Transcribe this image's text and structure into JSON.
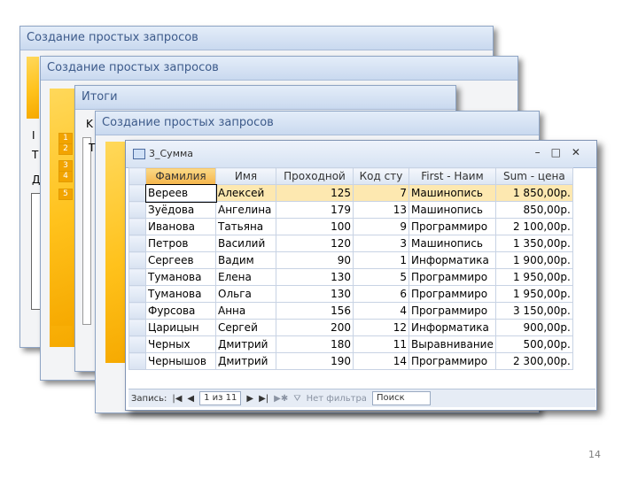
{
  "windows": {
    "w1_title": "Создание простых запросов",
    "w2_title": "Создание простых запросов",
    "w3_title": "Итоги",
    "w4_title": "Создание простых запросов",
    "w1_left_chars": [
      "I",
      "T",
      "Д"
    ],
    "w3_numbers": [
      "1",
      "2",
      "3",
      "4",
      "5"
    ],
    "w3_left_chars": [
      "K"
    ],
    "w4_left_chars": [
      "T"
    ]
  },
  "datasheet": {
    "title": "3_Сумма",
    "columns": [
      "Фамилия",
      "Имя",
      "Проходной",
      "Код сту",
      "First - Наим",
      "Sum - цена"
    ],
    "rows": [
      [
        "Вереев",
        "Алексей",
        "125",
        "7",
        "Машинопись",
        "1 850,00р."
      ],
      [
        "Зуёдова",
        "Ангелина",
        "179",
        "13",
        "Машинопись",
        "850,00р."
      ],
      [
        "Иванова",
        "Татьяна",
        "100",
        "9",
        "Программиро",
        "2 100,00р."
      ],
      [
        "Петров",
        "Василий",
        "120",
        "3",
        "Машинопись",
        "1 350,00р."
      ],
      [
        "Сергеев",
        "Вадим",
        "90",
        "1",
        "Информатика",
        "1 900,00р."
      ],
      [
        "Туманова",
        "Елена",
        "130",
        "5",
        "Программиро",
        "1 950,00р."
      ],
      [
        "Туманова",
        "Ольга",
        "130",
        "6",
        "Программиро",
        "1 950,00р."
      ],
      [
        "Фурсова",
        "Анна",
        "156",
        "4",
        "Программиро",
        "3 150,00р."
      ],
      [
        "Царицын",
        "Сергей",
        "200",
        "12",
        "Информатика",
        "900,00р."
      ],
      [
        "Черных",
        "Дмитрий",
        "180",
        "11",
        "Выравнивание",
        "500,00р."
      ],
      [
        "Чернышов",
        "Дмитрий",
        "190",
        "14",
        "Программиро",
        "2 300,00р."
      ]
    ],
    "nav": {
      "record_label": "Запись:",
      "record_position": "1 из 11",
      "filter_label": "Нет фильтра",
      "search_label": "Поиск"
    }
  },
  "page_number": "14"
}
